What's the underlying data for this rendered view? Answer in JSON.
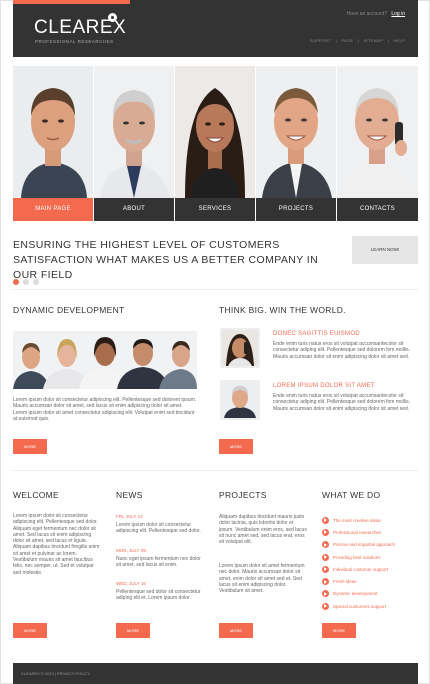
{
  "header": {
    "logo": "CLEAREX",
    "tagline": "PROFESSIONAL RESEARCHES",
    "account_prompt": "Have an account?",
    "login": "Log in",
    "links": [
      "SUPPORT",
      "|",
      "PAGE",
      "|",
      "SITEMAP",
      "|",
      "HELP"
    ]
  },
  "nav": [
    {
      "label": "MAIN PAGE",
      "active": true
    },
    {
      "label": "ABOUT",
      "active": false
    },
    {
      "label": "SERVICES",
      "active": false
    },
    {
      "label": "PROJECTS",
      "active": false
    },
    {
      "label": "CONTACTS",
      "active": false
    }
  ],
  "intro": {
    "title": "ENSURING THE HIGHEST LEVEL OF CUSTOMERS SATISFACTION WHAT MAKES US A BETTER COMPANY IN OUR FIELD",
    "button": "LEARN NOW!"
  },
  "dynamic": {
    "title": "DYNAMIC DEVELOPMENT",
    "text": "Lorem ipsum dolor sit consectetur adipiscing elit. Pellentesque sed dolorem ipsum. Mauris accumsan dolor sit amet, sed lacus sit enim adipiscing dolor sit amet. Lorem ipsum dolor sit amet consectetur adipiscing elit. Volutpat enim sed tincidunt at euismod quis.",
    "more": "MORE"
  },
  "world": {
    "title": "THINK BIG. WIN THE WORLD.",
    "item1_title": "DONEC SAGITTIS EUISMOD",
    "item1_text": "Ende enim turis natus eros sit volutpat accumsantecolor sit consectetur adiping elit. Pellentesque sed dolorem fom mollis. Mauris accumsan dolor sit enim adipiscing dolor sit amet sed.",
    "item2_title": "LOREM IPSUM DOLOR SIT AMET",
    "item2_text": "Ende enim turis natus eros sit volutpat accumsantecolor sit consectetur adiping elit. Pellentesque sed dolorem fom mollis. Mauris accumsan dolor sit enim adipiscing dolor sit amet sed.",
    "more": "MORE"
  },
  "welcome": {
    "title": "WELCOME",
    "text": "Lorem ipsum dolor sit consectetur adipiscing elit. Pellentesque sed dolor. Aliquam eget fermentum nec dolor sit amet. Sed lacus sit enim adipiscing dolor sit amet, sed lacus et ligula. Aliquam dapibus tincidunt fringilla enim sit amet et pulvinar ac lorem. Vestibulum mauris sit amet faucibus felis, nec semper, ut. Sed et volutpat sed molestie.",
    "more": "MORE"
  },
  "news": {
    "title": "NEWS",
    "items": [
      {
        "date": "FRI, JULY 13",
        "text": "Lorem ipsum dolor sit consectetur adipiscing elit. Pellentesque sed dolor."
      },
      {
        "date": "MON, JULY 09",
        "text": "Nunc eget ipsum fermentum nec dolor sit amet, sed lacus sit enim."
      },
      {
        "date": "WED, JULY 16",
        "text": "Pellentesque sed dolor sit consectetur adiping elit et. Lorem ipsum dolor."
      }
    ],
    "more": "MORE"
  },
  "projects": {
    "title": "PROJECTS",
    "text1": "Aliquam dapibus tincidunt mauris justo dolor lacinia, quis lobortis dolor et ipsum. Vestibulum enim eros, sed lacus sit nunc amet sed, sed lacus erat, eros sit volutpat elit.",
    "text2": "Lorem ipsum dolor sit amet fermentum nec dolor. Mauris accumsan dolor sit amet, enim dolor sit amet sed et. Sed lacus sit enim adipiscing dolor. Vestibulum sit amet.",
    "more": "MORE"
  },
  "whatwedo": {
    "title": "WHAT WE DO",
    "items": [
      "The most creative ideas",
      "Professional researches",
      "Precise and impartial approach",
      "Providing best solutions",
      "Individual customer support",
      "Fresh ideas",
      "Dynamic development",
      "Special customers support"
    ],
    "more": "MORE"
  },
  "footer": {
    "text": "CLEAREX © 2013 | PRIVACY POLICY"
  },
  "colors": {
    "accent": "#f36a4f",
    "dark": "#333333"
  }
}
